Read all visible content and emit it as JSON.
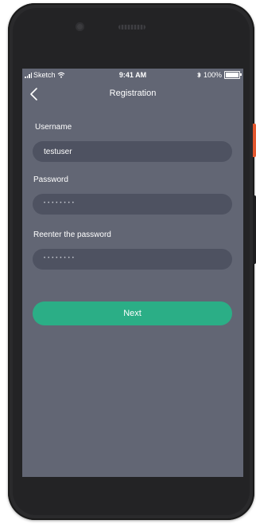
{
  "status_bar": {
    "carrier": "Sketch",
    "time": "9:41 AM",
    "battery": "100%"
  },
  "nav": {
    "title": "Registration",
    "back_icon": "chevron-left-icon"
  },
  "form": {
    "username": {
      "label": "Username",
      "value": "testuser"
    },
    "password": {
      "label": "Password",
      "masked_value": "••••••••"
    },
    "reenter_password": {
      "label": "Reenter the password",
      "masked_value": "••••••••"
    },
    "next_label": "Next"
  },
  "colors": {
    "screen_bg": "#626674",
    "field_bg": "#4e5261",
    "primary_button": "#2bae86",
    "phone_body": "#2a2a2c"
  }
}
